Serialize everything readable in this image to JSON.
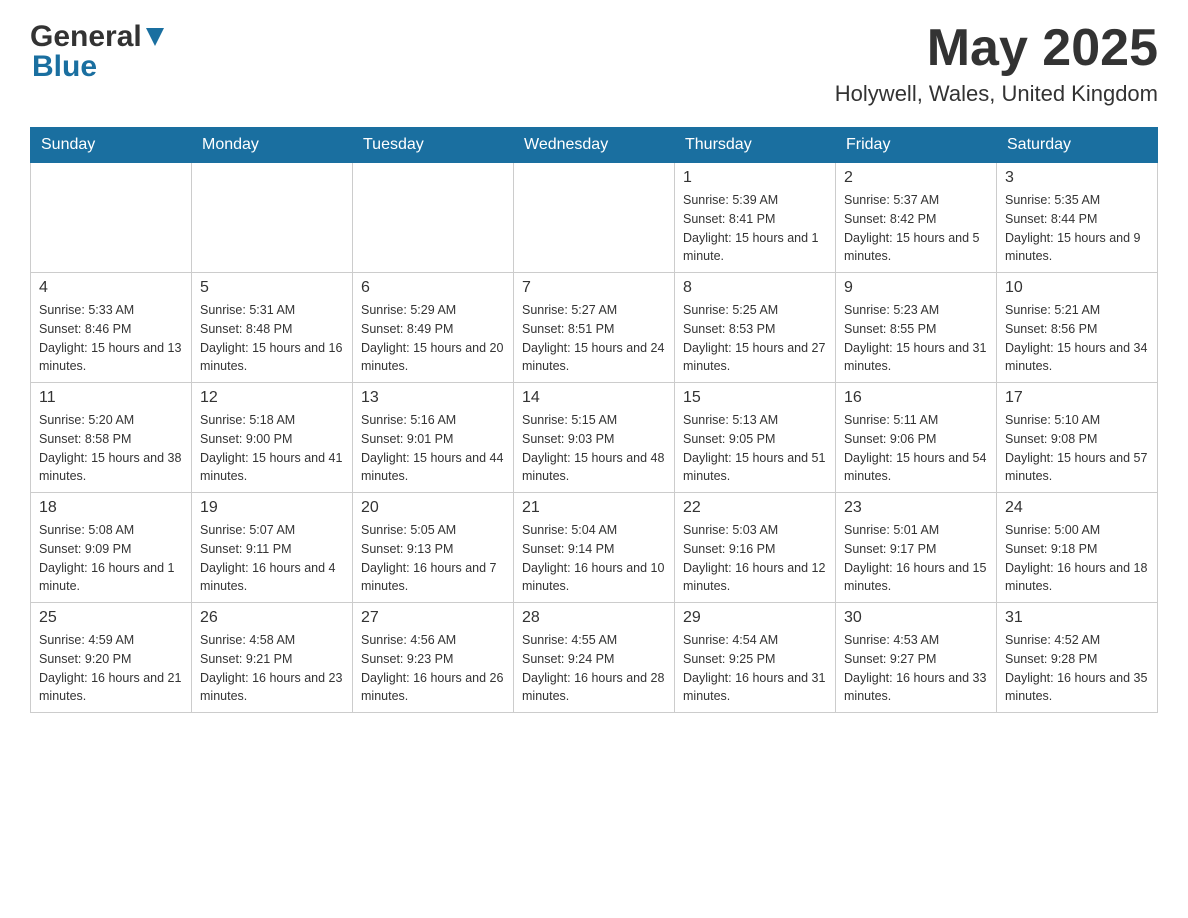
{
  "header": {
    "logo_general": "General",
    "logo_blue": "Blue",
    "month_year": "May 2025",
    "location": "Holywell, Wales, United Kingdom"
  },
  "weekdays": [
    "Sunday",
    "Monday",
    "Tuesday",
    "Wednesday",
    "Thursday",
    "Friday",
    "Saturday"
  ],
  "rows": [
    {
      "cells": [
        {
          "day": "",
          "info": ""
        },
        {
          "day": "",
          "info": ""
        },
        {
          "day": "",
          "info": ""
        },
        {
          "day": "",
          "info": ""
        },
        {
          "day": "1",
          "info": "Sunrise: 5:39 AM\nSunset: 8:41 PM\nDaylight: 15 hours and 1 minute."
        },
        {
          "day": "2",
          "info": "Sunrise: 5:37 AM\nSunset: 8:42 PM\nDaylight: 15 hours and 5 minutes."
        },
        {
          "day": "3",
          "info": "Sunrise: 5:35 AM\nSunset: 8:44 PM\nDaylight: 15 hours and 9 minutes."
        }
      ]
    },
    {
      "cells": [
        {
          "day": "4",
          "info": "Sunrise: 5:33 AM\nSunset: 8:46 PM\nDaylight: 15 hours and 13 minutes."
        },
        {
          "day": "5",
          "info": "Sunrise: 5:31 AM\nSunset: 8:48 PM\nDaylight: 15 hours and 16 minutes."
        },
        {
          "day": "6",
          "info": "Sunrise: 5:29 AM\nSunset: 8:49 PM\nDaylight: 15 hours and 20 minutes."
        },
        {
          "day": "7",
          "info": "Sunrise: 5:27 AM\nSunset: 8:51 PM\nDaylight: 15 hours and 24 minutes."
        },
        {
          "day": "8",
          "info": "Sunrise: 5:25 AM\nSunset: 8:53 PM\nDaylight: 15 hours and 27 minutes."
        },
        {
          "day": "9",
          "info": "Sunrise: 5:23 AM\nSunset: 8:55 PM\nDaylight: 15 hours and 31 minutes."
        },
        {
          "day": "10",
          "info": "Sunrise: 5:21 AM\nSunset: 8:56 PM\nDaylight: 15 hours and 34 minutes."
        }
      ]
    },
    {
      "cells": [
        {
          "day": "11",
          "info": "Sunrise: 5:20 AM\nSunset: 8:58 PM\nDaylight: 15 hours and 38 minutes."
        },
        {
          "day": "12",
          "info": "Sunrise: 5:18 AM\nSunset: 9:00 PM\nDaylight: 15 hours and 41 minutes."
        },
        {
          "day": "13",
          "info": "Sunrise: 5:16 AM\nSunset: 9:01 PM\nDaylight: 15 hours and 44 minutes."
        },
        {
          "day": "14",
          "info": "Sunrise: 5:15 AM\nSunset: 9:03 PM\nDaylight: 15 hours and 48 minutes."
        },
        {
          "day": "15",
          "info": "Sunrise: 5:13 AM\nSunset: 9:05 PM\nDaylight: 15 hours and 51 minutes."
        },
        {
          "day": "16",
          "info": "Sunrise: 5:11 AM\nSunset: 9:06 PM\nDaylight: 15 hours and 54 minutes."
        },
        {
          "day": "17",
          "info": "Sunrise: 5:10 AM\nSunset: 9:08 PM\nDaylight: 15 hours and 57 minutes."
        }
      ]
    },
    {
      "cells": [
        {
          "day": "18",
          "info": "Sunrise: 5:08 AM\nSunset: 9:09 PM\nDaylight: 16 hours and 1 minute."
        },
        {
          "day": "19",
          "info": "Sunrise: 5:07 AM\nSunset: 9:11 PM\nDaylight: 16 hours and 4 minutes."
        },
        {
          "day": "20",
          "info": "Sunrise: 5:05 AM\nSunset: 9:13 PM\nDaylight: 16 hours and 7 minutes."
        },
        {
          "day": "21",
          "info": "Sunrise: 5:04 AM\nSunset: 9:14 PM\nDaylight: 16 hours and 10 minutes."
        },
        {
          "day": "22",
          "info": "Sunrise: 5:03 AM\nSunset: 9:16 PM\nDaylight: 16 hours and 12 minutes."
        },
        {
          "day": "23",
          "info": "Sunrise: 5:01 AM\nSunset: 9:17 PM\nDaylight: 16 hours and 15 minutes."
        },
        {
          "day": "24",
          "info": "Sunrise: 5:00 AM\nSunset: 9:18 PM\nDaylight: 16 hours and 18 minutes."
        }
      ]
    },
    {
      "cells": [
        {
          "day": "25",
          "info": "Sunrise: 4:59 AM\nSunset: 9:20 PM\nDaylight: 16 hours and 21 minutes."
        },
        {
          "day": "26",
          "info": "Sunrise: 4:58 AM\nSunset: 9:21 PM\nDaylight: 16 hours and 23 minutes."
        },
        {
          "day": "27",
          "info": "Sunrise: 4:56 AM\nSunset: 9:23 PM\nDaylight: 16 hours and 26 minutes."
        },
        {
          "day": "28",
          "info": "Sunrise: 4:55 AM\nSunset: 9:24 PM\nDaylight: 16 hours and 28 minutes."
        },
        {
          "day": "29",
          "info": "Sunrise: 4:54 AM\nSunset: 9:25 PM\nDaylight: 16 hours and 31 minutes."
        },
        {
          "day": "30",
          "info": "Sunrise: 4:53 AM\nSunset: 9:27 PM\nDaylight: 16 hours and 33 minutes."
        },
        {
          "day": "31",
          "info": "Sunrise: 4:52 AM\nSunset: 9:28 PM\nDaylight: 16 hours and 35 minutes."
        }
      ]
    }
  ]
}
